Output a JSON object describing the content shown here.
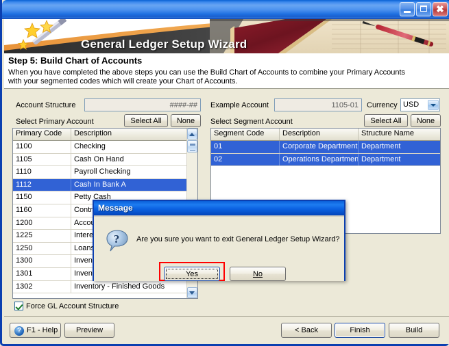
{
  "window": {
    "title": "",
    "minimize_label": "Minimize",
    "maximize_label": "Maximize",
    "close_label": "Close"
  },
  "banner": {
    "title": "General Ledger Setup Wizard",
    "wand_icon": "magic-wand-icon",
    "ledger_image": "ledger-book-and-pen-photo"
  },
  "step": {
    "title": "Step 5: Build Chart of Accounts",
    "description": "When you have completed the above steps you can use the Build Chart of Accounts to combine your Primary Accounts with your segmented codes which will create your Chart of Accounts."
  },
  "form": {
    "account_structure_label": "Account Structure",
    "account_structure_value": "####-##",
    "example_account_label": "Example Account",
    "example_account_value": "1105-01",
    "currency_label": "Currency",
    "currency_value": "USD",
    "currency_options": [
      "USD"
    ]
  },
  "primary": {
    "section_label": "Select Primary Account",
    "select_all_label": "Select All",
    "none_label": "None",
    "columns": [
      "Primary Code",
      "Description"
    ],
    "rows": [
      {
        "code": "1100",
        "description": "Checking",
        "selected": false
      },
      {
        "code": "1105",
        "description": "Cash On Hand",
        "selected": false
      },
      {
        "code": "1110",
        "description": "Payroll Checking",
        "selected": false
      },
      {
        "code": "1112",
        "description": "Cash In Bank A",
        "selected": true
      },
      {
        "code": "1150",
        "description": "Petty Cash",
        "selected": false
      },
      {
        "code": "1160",
        "description": "Contra Asset",
        "selected": false
      },
      {
        "code": "1200",
        "description": "Accounts Receivable",
        "selected": false
      },
      {
        "code": "1225",
        "description": "Interest Receivable",
        "selected": false
      },
      {
        "code": "1250",
        "description": "Loans Receivable",
        "selected": false
      },
      {
        "code": "1300",
        "description": "Inventory",
        "selected": false
      },
      {
        "code": "1301",
        "description": "Inventory - Raw Materials",
        "selected": false
      },
      {
        "code": "1302",
        "description": "Inventory - Finished Goods",
        "selected": false
      }
    ]
  },
  "segment": {
    "section_label": "Select Segment Account",
    "select_all_label": "Select All",
    "none_label": "None",
    "columns": [
      "Segment Code",
      "Description",
      "Structure Name"
    ],
    "rows": [
      {
        "code": "01",
        "description": "Corporate Department",
        "structure": "Department",
        "selected": true
      },
      {
        "code": "02",
        "description": "Operations Department",
        "structure": "Department",
        "selected": true
      }
    ]
  },
  "options": {
    "force_structure_label": "Force GL Account Structure",
    "force_structure_checked": true
  },
  "footer": {
    "help_label": "F1 - Help",
    "help_icon": "question-mark-icon",
    "preview_label": "Preview",
    "back_label": "< Back",
    "finish_label": "Finish",
    "build_label": "Build"
  },
  "dialog": {
    "title": "Message",
    "icon": "question-bubble-icon",
    "message": "Are you sure you want to exit General Ledger Setup Wizard?",
    "yes_label": "Yes",
    "no_label": "No",
    "focus_highlight_color": "#ff0000"
  }
}
